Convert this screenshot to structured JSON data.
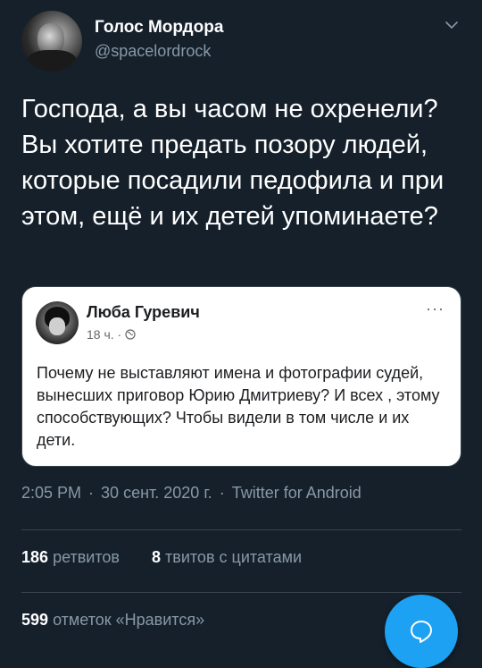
{
  "author": {
    "display_name": "Голос Мордора",
    "handle": "@spacelordrock"
  },
  "tweet": {
    "text": "Господа, а вы часом не охренели? Вы хотите предать позору людей, которые посадили педофила и при этом, ещё и их детей упоминаете?"
  },
  "embedded_post": {
    "author_name": "Люба Гуревич",
    "time": "18 ч. ·",
    "more_label": "···",
    "text": "Почему не выставляют имена и фотографии судей, вынесших приговор Юрию Дмитриеву? И всех , этому способствующих? Чтобы видели в том числе и их дети."
  },
  "meta": {
    "time": "2:05 PM",
    "separator": "·",
    "date": "30 сент. 2020 г.",
    "source": "Twitter for Android"
  },
  "stats": {
    "retweets_count": "186",
    "retweets_label": "ретвитов",
    "quotes_count": "8",
    "quotes_label": "твитов с цитатами",
    "likes_count": "599",
    "likes_label": "отметок «Нравится»"
  },
  "colors": {
    "background": "#15202b",
    "text_primary": "#ffffff",
    "text_secondary": "#8899a6",
    "divider": "#38444d",
    "accent": "#1da1f2",
    "card_bg": "#ffffff"
  },
  "icons": {
    "chevron": "chevron-down-icon",
    "globe": "globe-icon",
    "compose": "compose-reply-icon"
  }
}
